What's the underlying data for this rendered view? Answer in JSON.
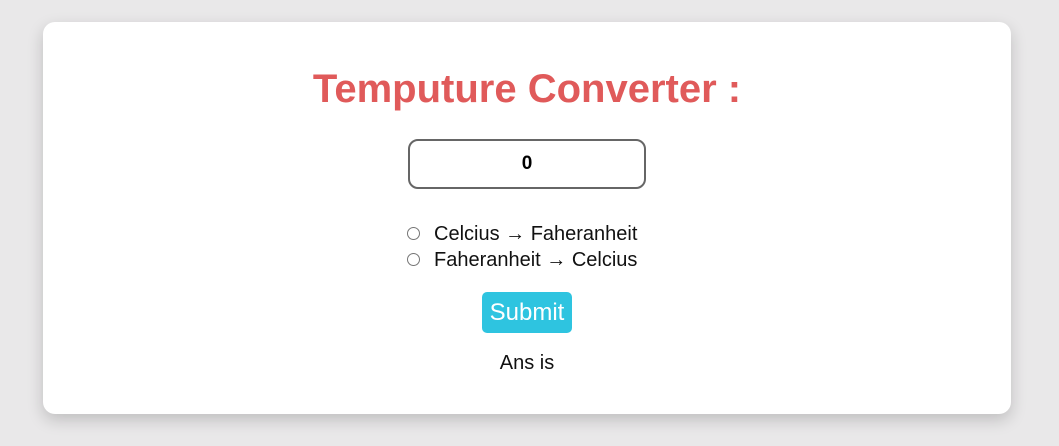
{
  "title": "Temputure Converter :",
  "input": {
    "value": "0"
  },
  "options": [
    {
      "label": "Celcius → Faheranheit",
      "selected": false
    },
    {
      "label": "Faheranheit → Celcius",
      "selected": false
    }
  ],
  "submit_label": "Submit",
  "answer_text": "Ans is",
  "colors": {
    "background": "#e9e8e9",
    "title": "#e05a5a",
    "submit_button": "#2ec4e0"
  }
}
